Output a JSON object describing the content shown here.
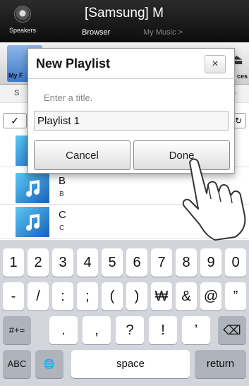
{
  "header": {
    "speakers_label": "Speakers",
    "title": "[Samsung] M",
    "tab_browser": "Browser",
    "tab_mymusic": "My Music >"
  },
  "toolbar": {
    "left_label": "My F",
    "right_label": "ces",
    "sort_s": "S",
    "plus": "+"
  },
  "list": {
    "items": [
      {
        "title": "B",
        "subtitle": "B"
      },
      {
        "title": "C",
        "subtitle": "C"
      }
    ]
  },
  "dialog": {
    "title": "New Playlist",
    "close_glyph": "×",
    "hint": "Enter a title.",
    "input_value": "Playlist 1",
    "cancel_label": "Cancel",
    "done_label": "Done"
  },
  "keyboard": {
    "row1": [
      "1",
      "2",
      "3",
      "4",
      "5",
      "6",
      "7",
      "8",
      "9",
      "0"
    ],
    "row2": [
      "-",
      "/",
      ":",
      ";",
      "(",
      ")",
      "₩",
      "&",
      "@",
      "”"
    ],
    "row3_mode": "#+=",
    "row3": [
      ".",
      ",",
      "?",
      "!",
      "’"
    ],
    "row3_delete": "⌫",
    "row4_abc": "ABC",
    "row4_globe": "🌐",
    "row4_space": "space",
    "row4_return": "return"
  },
  "colors": {
    "header_bg": "#1a1a1a",
    "accent_blue": "#3a78c9",
    "keyboard_bg": "#d2d5db"
  }
}
